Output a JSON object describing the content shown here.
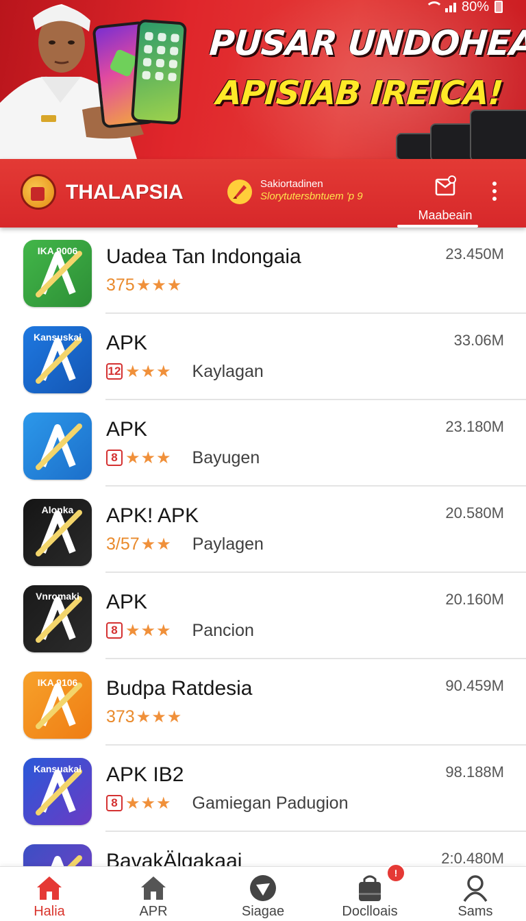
{
  "status": {
    "battery_text": "80%"
  },
  "banner": {
    "title": "PUSAR UNDOHEAN",
    "subtitle": "APISIAB IREICA!"
  },
  "appbar": {
    "brand_name": "THALAPSIA",
    "promo_line1": "Sakiortadinen",
    "promo_line2": "Slorytutersbntuem 'p 9",
    "inbox_label": "Maabeain",
    "more_icon": "more-vert-icon"
  },
  "apps": [
    {
      "title": "Uadea Tan Indongaia",
      "size": "23.450M",
      "rating_text": "375",
      "badge": "",
      "stars": "★★★",
      "developer": "",
      "icon_tag": "IKA 9006",
      "colors": [
        "#42b649",
        "#2d8f36"
      ]
    },
    {
      "title": "APK",
      "size": "33.06M",
      "rating_text": "",
      "badge": "12",
      "stars": "★★★",
      "developer": "Kaylagan",
      "icon_tag": "Kansuskai",
      "colors": [
        "#1e78e0",
        "#1456b4"
      ]
    },
    {
      "title": "APK",
      "size": "23.180M",
      "rating_text": "",
      "badge": "8",
      "stars": "★★★",
      "developer": "Bayugen",
      "icon_tag": "",
      "colors": [
        "#2c98ea",
        "#1c6fca"
      ]
    },
    {
      "title": "APK! APK",
      "size": "20.580M",
      "rating_text": "3/57",
      "badge": "",
      "stars": "★★",
      "developer": "Paylagen",
      "icon_tag": "Alonka",
      "colors": [
        "#151515",
        "#2a2a2a"
      ]
    },
    {
      "title": "APK",
      "size": "20.160M",
      "rating_text": "",
      "badge": "8",
      "stars": "★★★",
      "developer": "Pancion",
      "icon_tag": "Vnromaki",
      "colors": [
        "#1a1a1a",
        "#2b2b2b"
      ]
    },
    {
      "title": "Budpa Ratdesia",
      "size": "90.459M",
      "rating_text": "373",
      "badge": "",
      "stars": "★★★",
      "developer": "",
      "icon_tag": "IKA 9106",
      "colors": [
        "#f7a12a",
        "#ef7d14"
      ]
    },
    {
      "title": "APK IB2",
      "size": "98.188M",
      "rating_text": "",
      "badge": "8",
      "stars": "★★★",
      "developer": "Gamiegan Padugion",
      "icon_tag": "Kansuakai",
      "colors": [
        "#2a59d8",
        "#6a3bc4"
      ]
    },
    {
      "title": "BavakÄlgakaai",
      "size": "2:0.480M",
      "rating_text": "",
      "badge": "",
      "stars": "",
      "developer": "",
      "icon_tag": "",
      "colors": [
        "#3b4fc4",
        "#7a3ec4"
      ]
    }
  ],
  "nav": [
    {
      "label": "Halia",
      "icon": "home-icon",
      "active": true
    },
    {
      "label": "APR",
      "icon": "home-outline-icon",
      "active": false
    },
    {
      "label": "Siagae",
      "icon": "navigate-icon",
      "active": false
    },
    {
      "label": "Doclloais",
      "icon": "shopping-bag-icon",
      "active": false
    },
    {
      "label": "Sams",
      "icon": "person-icon",
      "active": false
    }
  ],
  "nav_badge": "!",
  "accent": "#e0262b"
}
